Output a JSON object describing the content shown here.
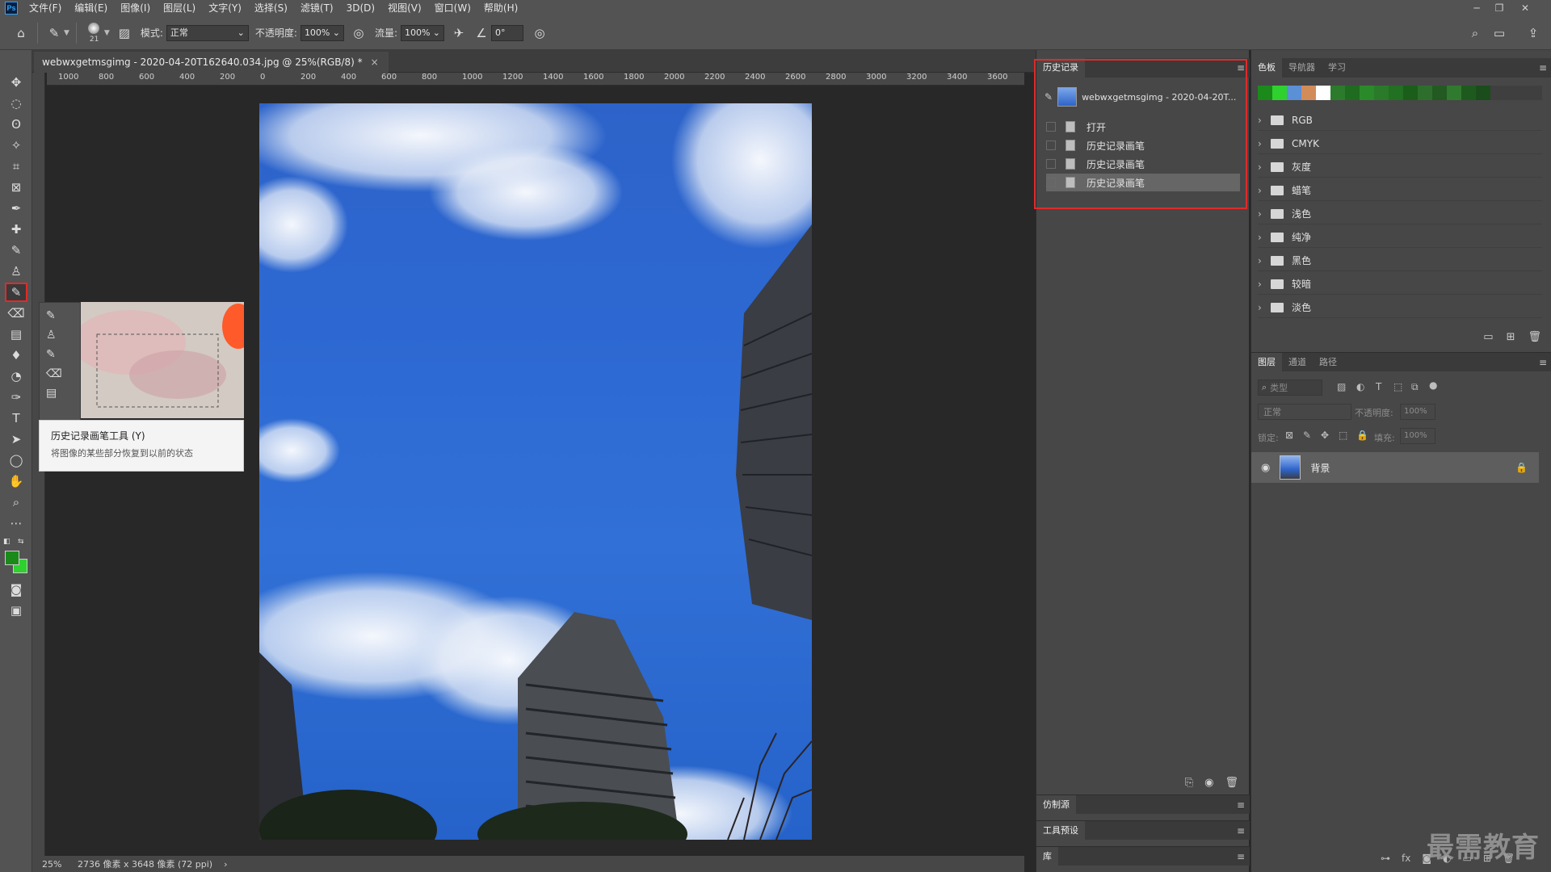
{
  "app": {
    "logo_text": "Ps",
    "menus": [
      "文件(F)",
      "编辑(E)",
      "图像(I)",
      "图层(L)",
      "文字(Y)",
      "选择(S)",
      "滤镜(T)",
      "3D(D)",
      "视图(V)",
      "窗口(W)",
      "帮助(H)"
    ],
    "window_controls": {
      "minimize": "─",
      "restore": "❐",
      "close": "✕"
    }
  },
  "options_bar": {
    "brush_size": "21",
    "mode_label": "模式:",
    "mode_value": "正常",
    "opacity_label": "不透明度:",
    "opacity_value": "100%",
    "flow_label": "流量:",
    "flow_value": "100%",
    "angle_value": "0°"
  },
  "document": {
    "tab_title": "webwxgetmsgimg - 2020-04-20T162640.034.jpg @ 25%(RGB/8) *",
    "close": "×",
    "ruler_h_labels": [
      "1000",
      "800",
      "600",
      "400",
      "200",
      "0",
      "200",
      "400",
      "600",
      "800",
      "1000",
      "1200",
      "1400",
      "1600",
      "1800",
      "2000",
      "2200",
      "2400",
      "2600",
      "2800",
      "3000",
      "3200",
      "3400",
      "3600"
    ],
    "zoom": "25%",
    "status_info": "2736 像素 x 3648 像素 (72 ppi)",
    "status_arrow": "›"
  },
  "tooltip": {
    "title": "历史记录画笔工具 (Y)",
    "description": "将图像的某些部分恢复到以前的状态"
  },
  "history_panel": {
    "tab": "历史记录",
    "snapshot_name": "webwxgetmsgimg - 2020-04-20T...",
    "states": [
      "打开",
      "历史记录画笔",
      "历史记录画笔",
      "历史记录画笔"
    ],
    "selected_index": 3
  },
  "collapsed_panels": [
    "仿制源",
    "工具预设",
    "库"
  ],
  "swatches_panel": {
    "tabs": [
      "色板",
      "导航器",
      "学习"
    ],
    "active_tab": 0,
    "recent_colors": [
      "#1b8a1b",
      "#2fd12f",
      "#5b8fd6",
      "#d28c5a",
      "#ffffff",
      "#2c7b2c",
      "#1f6b1f",
      "#2a8a2a",
      "#2a7a2a",
      "#227022",
      "#1a5e1a",
      "#2d6e2d",
      "#225a22",
      "#2f7a2f",
      "#1e5a1e",
      "#1b4c1b"
    ],
    "folders": [
      "RGB",
      "CMYK",
      "灰度",
      "蜡笔",
      "浅色",
      "纯净",
      "黑色",
      "较暗",
      "淡色"
    ]
  },
  "layers_panel": {
    "tabs": [
      "图层",
      "通道",
      "路径"
    ],
    "active_tab": 0,
    "filter_placeholder": "类型",
    "blend_mode": "正常",
    "opacity_label": "不透明度:",
    "opacity_value": "100%",
    "lock_label": "锁定:",
    "fill_label": "填充:",
    "fill_value": "100%",
    "layers": [
      {
        "name": "背景",
        "locked": true,
        "visible": true
      }
    ]
  },
  "watermark": "最需教育",
  "colors": {
    "accent_highlight": "#e12a2a",
    "foreground_color": "#1b8a1b",
    "background_color": "#2fd12f"
  }
}
